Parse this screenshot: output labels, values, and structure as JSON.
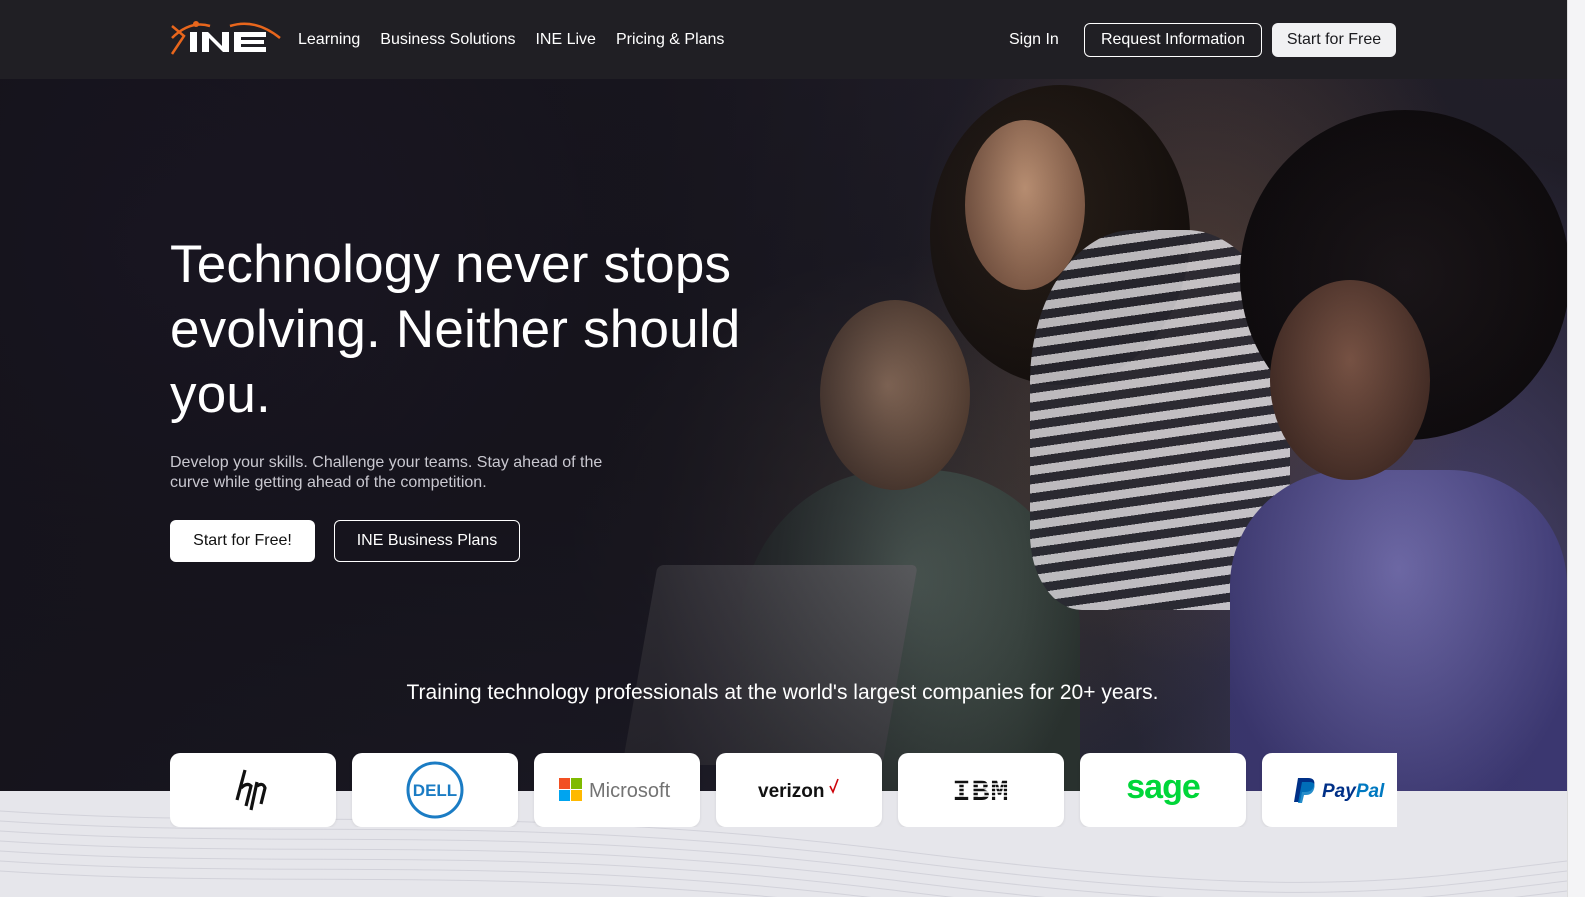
{
  "brand": {
    "name": "INE",
    "accent": "#e8661c"
  },
  "nav": {
    "links": [
      "Learning",
      "Business Solutions",
      "INE Live",
      "Pricing & Plans"
    ],
    "sign_in": "Sign In",
    "request_info": "Request Information",
    "start_free": "Start for Free"
  },
  "hero": {
    "title": "Technology never stops evolving. Neither should you.",
    "subtitle": "Develop your skills. Challenge your teams. Stay ahead of the curve while getting ahead of the competition.",
    "cta_primary": "Start for Free!",
    "cta_secondary": "INE Business Plans"
  },
  "customers": {
    "tagline": "Training technology professionals at the world's largest companies for 20+ years.",
    "logos": [
      "hp",
      "DELL",
      "Microsoft",
      "verizon",
      "IBM",
      "sage",
      "PayPal"
    ]
  }
}
